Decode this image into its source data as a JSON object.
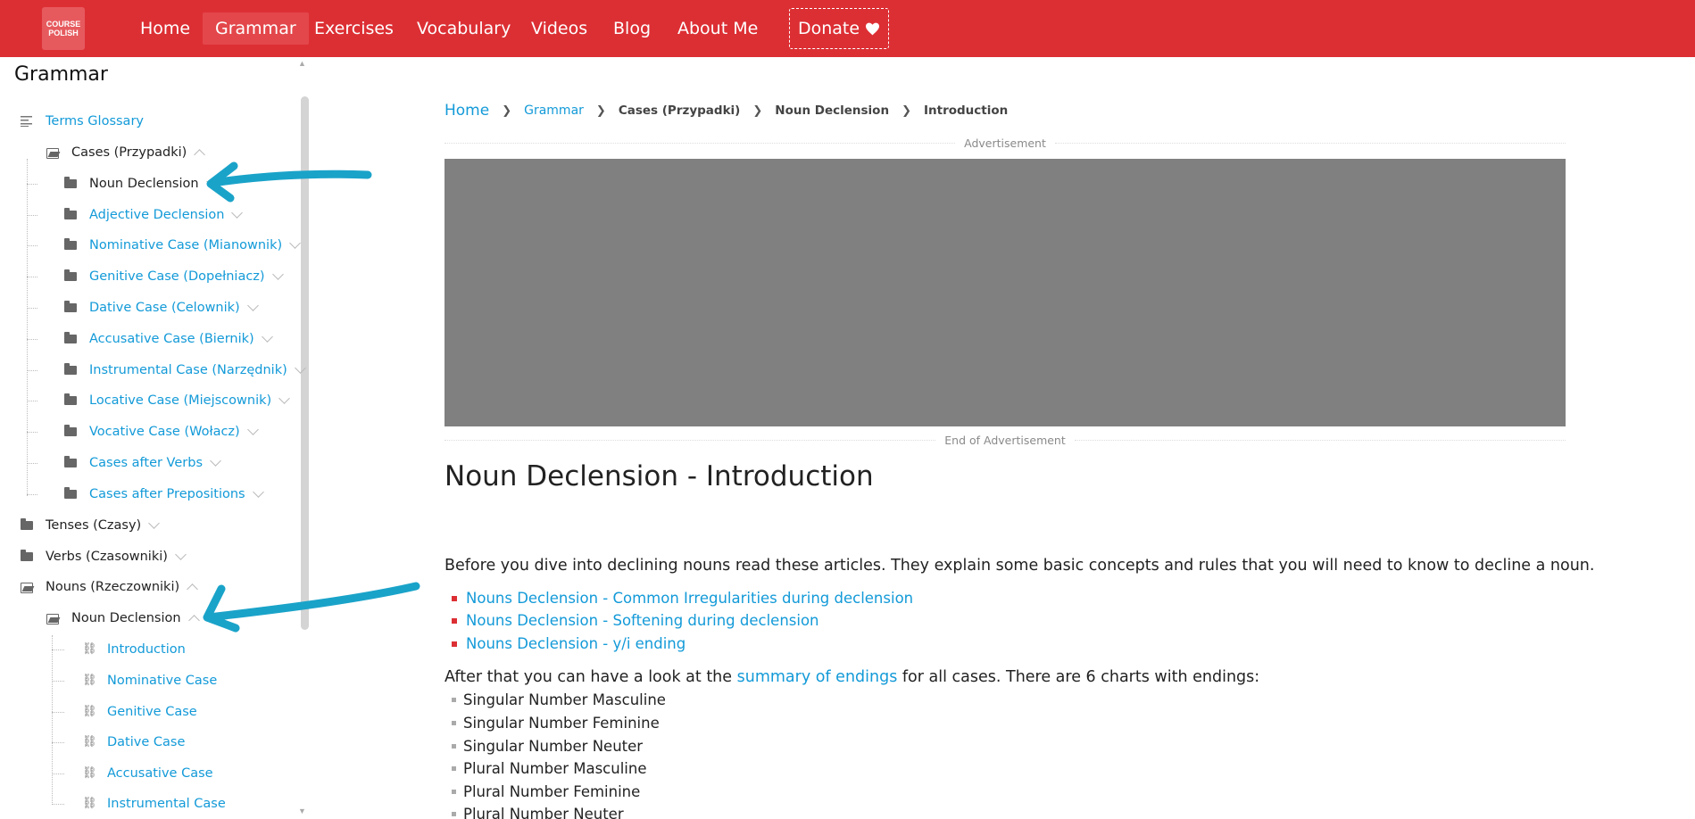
{
  "navbar": {
    "logo_line1": "COURSE",
    "logo_line2": "POLISH",
    "items": [
      {
        "label": "Home"
      },
      {
        "label": "Grammar"
      },
      {
        "label": "Exercises"
      },
      {
        "label": "Vocabulary"
      },
      {
        "label": "Videos"
      },
      {
        "label": "Blog"
      },
      {
        "label": "About Me"
      }
    ],
    "donate_label": "Donate",
    "donate_icon": "heart-icon",
    "active": "Grammar",
    "brand_color": "#dc2f34"
  },
  "sidebar": {
    "title": "Grammar",
    "items": [
      {
        "label": "Terms Glossary",
        "icon": "list-icon",
        "style": "link"
      },
      {
        "label": "Cases (Przypadki)",
        "icon": "folder-open-icon",
        "style": "dark",
        "chevron": "up"
      },
      {
        "label": "Noun Declension",
        "icon": "folder-icon",
        "style": "dark",
        "chevron": "down"
      },
      {
        "label": "Adjective Declension",
        "icon": "folder-icon",
        "style": "link",
        "chevron": "down"
      },
      {
        "label": "Nominative Case (Mianownik)",
        "icon": "folder-icon",
        "style": "link",
        "chevron": "down"
      },
      {
        "label": "Genitive Case (Dopełniacz)",
        "icon": "folder-icon",
        "style": "link",
        "chevron": "down"
      },
      {
        "label": "Dative Case (Celownik)",
        "icon": "folder-icon",
        "style": "link",
        "chevron": "down"
      },
      {
        "label": "Accusative Case (Biernik)",
        "icon": "folder-icon",
        "style": "link",
        "chevron": "down"
      },
      {
        "label": "Instrumental Case (Narzędnik)",
        "icon": "folder-icon",
        "style": "link",
        "chevron": "down"
      },
      {
        "label": "Locative Case (Miejscownik)",
        "icon": "folder-icon",
        "style": "link",
        "chevron": "down"
      },
      {
        "label": "Vocative Case (Wołacz)",
        "icon": "folder-icon",
        "style": "link",
        "chevron": "down"
      },
      {
        "label": "Cases after Verbs",
        "icon": "folder-icon",
        "style": "link",
        "chevron": "down"
      },
      {
        "label": "Cases after Prepositions",
        "icon": "folder-icon",
        "style": "link",
        "chevron": "down"
      },
      {
        "label": "Tenses (Czasy)",
        "icon": "folder-icon",
        "style": "dark",
        "chevron": "down"
      },
      {
        "label": "Verbs (Czasowniki)",
        "icon": "folder-icon",
        "style": "dark",
        "chevron": "down"
      },
      {
        "label": "Nouns (Rzeczowniki)",
        "icon": "folder-open-icon",
        "style": "dark",
        "chevron": "up"
      },
      {
        "label": "Noun Declension",
        "icon": "folder-open-icon",
        "style": "dark",
        "chevron": "up"
      },
      {
        "label": "Introduction",
        "icon": "link-icon",
        "style": "link"
      },
      {
        "label": "Nominative Case",
        "icon": "link-icon",
        "style": "link"
      },
      {
        "label": "Genitive Case",
        "icon": "link-icon",
        "style": "link"
      },
      {
        "label": "Dative Case",
        "icon": "link-icon",
        "style": "link"
      },
      {
        "label": "Accusative Case",
        "icon": "link-icon",
        "style": "link"
      },
      {
        "label": "Instrumental Case",
        "icon": "link-icon",
        "style": "link"
      }
    ]
  },
  "breadcrumb": {
    "items": [
      "Home",
      "Grammar",
      "Cases (Przypadki)",
      "Noun Declension",
      "Introduction"
    ]
  },
  "ad": {
    "top_label": "Advertisement",
    "bottom_label": "End of Advertisement"
  },
  "article": {
    "title": "Noun Declension - Introduction",
    "intro": "Before you dive into declining nouns read these articles. They explain some basic concepts and rules that you will need to know to decline a noun.",
    "links": [
      "Nouns Declension - Common Irregularities during declension",
      "Nouns Declension - Softening during declension",
      "Nouns Declension - y/i ending"
    ],
    "summary_before": "After that you can have a look at the ",
    "summary_link": "summary of endings",
    "summary_after": " for all cases. There are 6 charts with endings:",
    "charts": [
      "Singular Number Masculine",
      "Singular Number Feminine",
      "Singular Number Neuter",
      "Plural Number Masculine",
      "Plural Number Feminine",
      "Plural Number Neuter"
    ]
  },
  "annotations": {
    "arrow_color": "#1aa3c9"
  }
}
